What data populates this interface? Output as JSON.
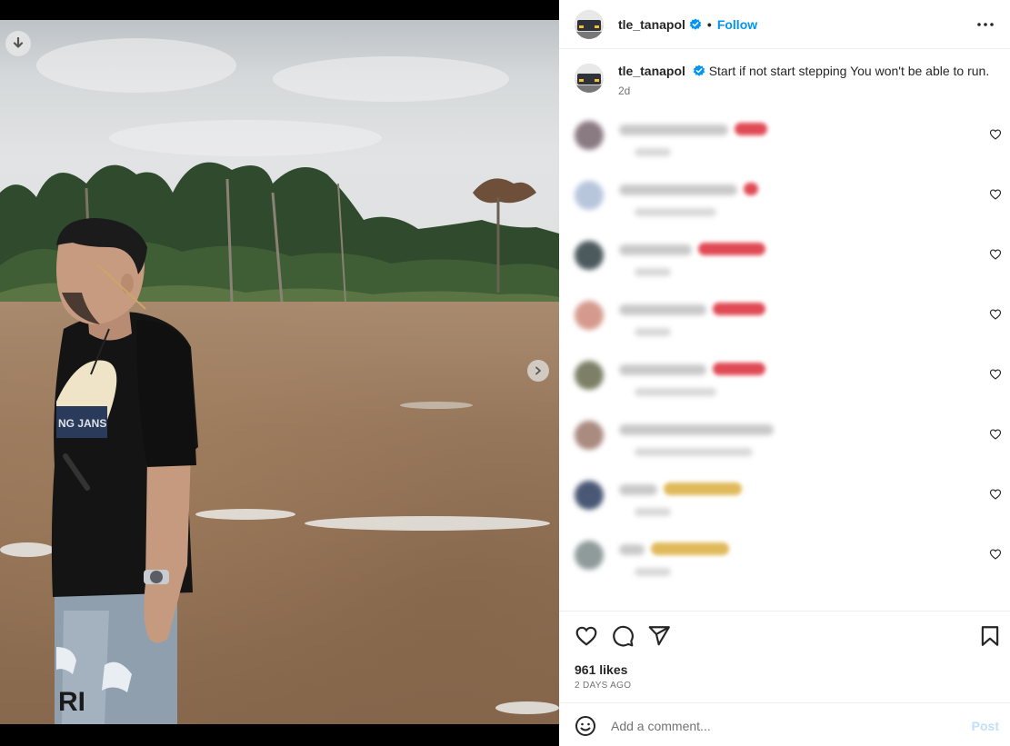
{
  "post": {
    "username": "tle_tanapol",
    "verified": true,
    "follow_label": "Follow",
    "separator": "•",
    "caption": "Start if not start stepping You won't be able to run.",
    "caption_time": "2d",
    "likes": "961 likes",
    "posted_ago": "2 DAYS AGO"
  },
  "comment_box": {
    "placeholder": "Add a comment...",
    "post_label": "Post"
  },
  "comments_blurred_count": 8,
  "icons": {
    "more": "more-options-icon",
    "download": "download-icon",
    "next": "chevron-right-icon",
    "like": "heart-icon",
    "comment": "comment-bubble-icon",
    "share": "paper-plane-icon",
    "save": "bookmark-icon",
    "emoji": "emoji-smile-icon"
  },
  "colors": {
    "accent": "#0095f6",
    "post_disabled": "#c0dffd",
    "verified": "#0095f6"
  }
}
